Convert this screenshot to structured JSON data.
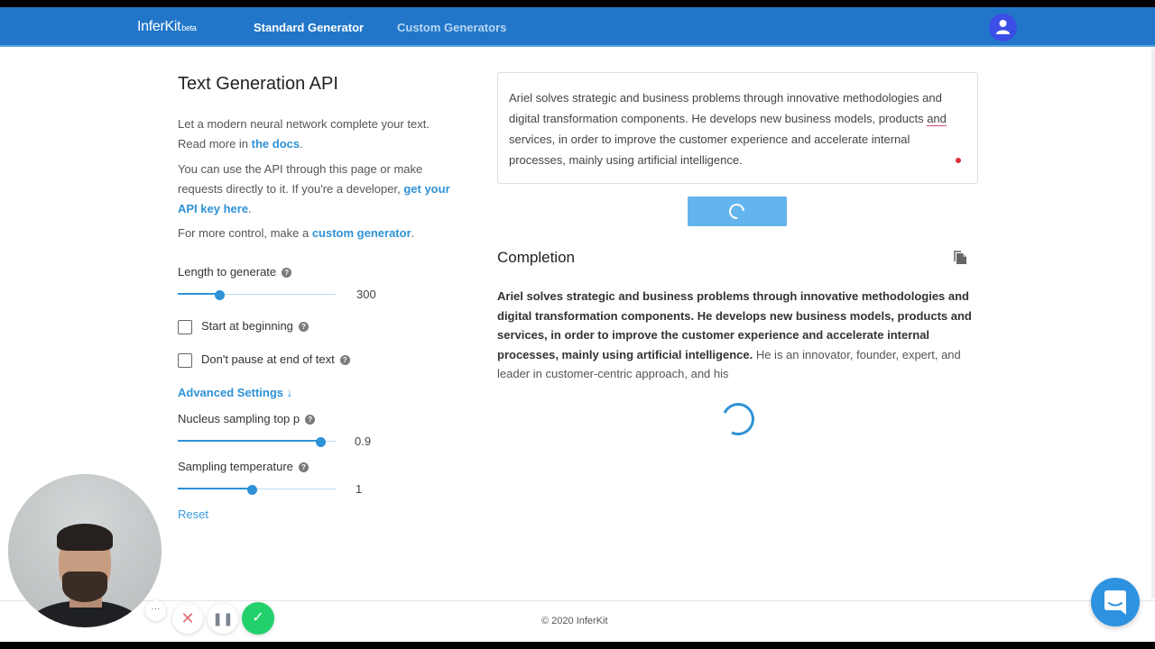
{
  "navbar": {
    "logo": "InferKit",
    "logo_suffix": "beta",
    "links": [
      {
        "label": "Standard Generator",
        "active": true
      },
      {
        "label": "Custom Generators",
        "active": false
      }
    ],
    "avatar_icon": "user-icon"
  },
  "sidebar": {
    "title": "Text Generation API",
    "intro_text": "Let a modern neural network complete your text.",
    "intro_read_more": "Read more in ",
    "intro_link": "the docs",
    "api_text": "You can use the API through this page or make requests directly to it. If you're a developer, ",
    "api_link": "get your API key here",
    "control_text": "For more control, make a ",
    "control_link": "custom generator",
    "period": ".",
    "length_label": "Length to generate",
    "length_value": "300",
    "length_fraction": 0.26,
    "start_at_beginning_label": "Start at beginning",
    "start_at_beginning_checked": false,
    "dont_pause_label": "Don't pause at end of text",
    "dont_pause_checked": false,
    "advanced_label": "Advanced Settings ↓",
    "top_p_label": "Nucleus sampling top p",
    "top_p_value": "0.9",
    "top_p_fraction": 0.9,
    "temperature_label": "Sampling temperature",
    "temperature_value": "1",
    "temperature_fraction": 0.47,
    "reset_label": "Reset",
    "help_glyph": "?"
  },
  "prompt": {
    "text_before": "Ariel solves strategic and business problems through innovative methodologies and digital transformation components. He develops new business models, products ",
    "text_flagged": "and",
    "text_after": " services, in order to improve the customer experience and accelerate internal processes, mainly using artificial intelligence."
  },
  "generate_button": {
    "state": "loading"
  },
  "completion": {
    "title": "Completion",
    "copy_icon": "copy-icon",
    "prompt_part": "Ariel solves strategic and business problems through innovative methodologies and digital transformation components. He develops new business models, products and services, in order to improve the customer experience and accelerate internal processes, mainly using artificial intelligence.",
    "generated_part": " He is an innovator, founder, expert, and leader in customer-centric approach, and his",
    "status": "loading"
  },
  "footer": {
    "copyright": "© 2020 InferKit"
  },
  "recorder": {
    "more_glyph": "···",
    "cancel_glyph": "✕",
    "pause_glyph": "❚❚",
    "done_glyph": "✓"
  },
  "colors": {
    "navbar": "#2176c9",
    "accent": "#2e92d6",
    "avatar": "#3b4ee6",
    "button_loading": "#64b5ee",
    "record_done": "#22d16b"
  }
}
